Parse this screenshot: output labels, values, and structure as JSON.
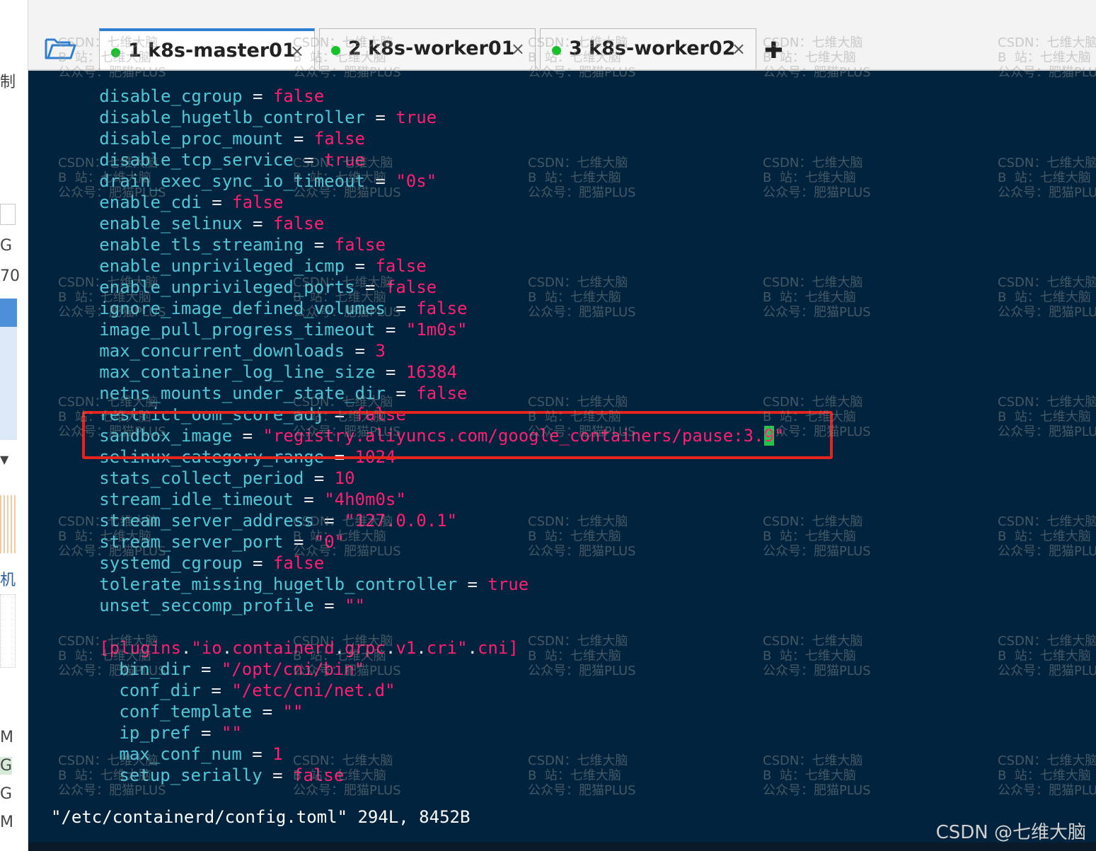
{
  "sidebar": {
    "fragments": [
      "制",
      "G",
      "70",
      "机",
      "M",
      "G",
      "G",
      "M"
    ]
  },
  "tabs": [
    {
      "label": "1 k8s-master01",
      "active": true
    },
    {
      "label": "2 k8s-worker01",
      "active": false
    },
    {
      "label": "3 k8s-worker02",
      "active": false
    }
  ],
  "tab_close_glyph": "×",
  "new_tab_glyph": "✚",
  "terminal": {
    "lines": [
      {
        "indent": 6,
        "key": "disable_cgroup",
        "op": " = ",
        "value": "false"
      },
      {
        "indent": 6,
        "key": "disable_hugetlb_controller",
        "op": " = ",
        "value": "true"
      },
      {
        "indent": 6,
        "key": "disable_proc_mount",
        "op": " = ",
        "value": "false"
      },
      {
        "indent": 6,
        "key": "disable_tcp_service",
        "op": " = ",
        "value": "true"
      },
      {
        "indent": 6,
        "key": "drain_exec_sync_io_timeout",
        "op": " = ",
        "value": "\"0s\""
      },
      {
        "indent": 6,
        "key": "enable_cdi",
        "op": " = ",
        "value": "false"
      },
      {
        "indent": 6,
        "key": "enable_selinux",
        "op": " = ",
        "value": "false"
      },
      {
        "indent": 6,
        "key": "enable_tls_streaming",
        "op": " = ",
        "value": "false"
      },
      {
        "indent": 6,
        "key": "enable_unprivileged_icmp",
        "op": " = ",
        "value": "false"
      },
      {
        "indent": 6,
        "key": "enable_unprivileged_ports",
        "op": " = ",
        "value": "false"
      },
      {
        "indent": 6,
        "key": "ignore_image_defined_volumes",
        "op": " = ",
        "value": "false"
      },
      {
        "indent": 6,
        "key": "image_pull_progress_timeout",
        "op": " = ",
        "value": "\"1m0s\""
      },
      {
        "indent": 6,
        "key": "max_concurrent_downloads",
        "op": " = ",
        "value": "3"
      },
      {
        "indent": 6,
        "key": "max_container_log_line_size",
        "op": " = ",
        "value": "16384"
      },
      {
        "indent": 6,
        "key": "netns_mounts_under_state_dir",
        "op": " = ",
        "value": "false"
      },
      {
        "indent": 6,
        "key": "restrict_oom_score_adj",
        "op": " = ",
        "value": "false"
      },
      {
        "indent": 6,
        "key": "sandbox_image",
        "op": " = ",
        "value": "\"registry.aliyuncs.com/google_containers/pause:3.",
        "cursor": "9",
        "tail": "\""
      },
      {
        "indent": 6,
        "key": "selinux_category_range",
        "op": " = ",
        "value": "1024"
      },
      {
        "indent": 6,
        "key": "stats_collect_period",
        "op": " = ",
        "value": "10"
      },
      {
        "indent": 6,
        "key": "stream_idle_timeout",
        "op": " = ",
        "value": "\"4h0m0s\""
      },
      {
        "indent": 6,
        "key": "stream_server_address",
        "op": " = ",
        "value": "\"127.0.0.1\""
      },
      {
        "indent": 6,
        "key": "stream_server_port",
        "op": " = ",
        "value": "\"0\""
      },
      {
        "indent": 6,
        "key": "systemd_cgroup",
        "op": " = ",
        "value": "false"
      },
      {
        "indent": 6,
        "key": "tolerate_missing_hugetlb_controller",
        "op": " = ",
        "value": "true"
      },
      {
        "indent": 6,
        "key": "unset_seccomp_profile",
        "op": " = ",
        "value": "\"\""
      },
      {
        "indent": 0,
        "key": "",
        "op": "",
        "value": ""
      },
      {
        "indent": 6,
        "section": true,
        "parts": [
          {
            "t": "[plugins",
            "c": "v"
          },
          {
            "t": ".",
            "c": "p"
          },
          {
            "t": "\"io",
            "c": "v"
          },
          {
            "t": ".",
            "c": "p"
          },
          {
            "t": "containerd",
            "c": "v"
          },
          {
            "t": ".",
            "c": "p"
          },
          {
            "t": "grpc",
            "c": "v"
          },
          {
            "t": ".",
            "c": "p"
          },
          {
            "t": "v1",
            "c": "v"
          },
          {
            "t": ".",
            "c": "p"
          },
          {
            "t": "cri\"",
            "c": "v"
          },
          {
            "t": ".",
            "c": "p"
          },
          {
            "t": "cni]",
            "c": "v"
          }
        ]
      },
      {
        "indent": 8,
        "key": "bin_dir",
        "op": " = ",
        "value": "\"/opt/cni/bin\""
      },
      {
        "indent": 8,
        "key": "conf_dir",
        "op": " = ",
        "value": "\"/etc/cni/net.d\""
      },
      {
        "indent": 8,
        "key": "conf_template",
        "op": " = ",
        "value": "\"\""
      },
      {
        "indent": 8,
        "key": "ip_pref",
        "op": " = ",
        "value": "\"\""
      },
      {
        "indent": 8,
        "key": "max_conf_num",
        "op": " = ",
        "value": "1"
      },
      {
        "indent": 8,
        "key": "setup_serially",
        "op": " = ",
        "value": "false"
      }
    ],
    "status": "\"/etc/containerd/config.toml\" 294L, 8452B"
  },
  "watermark": "CSDN：七维大脑\nB  站：七维大脑\n公众号：肥猫PLUS",
  "credit": "CSDN @七维大脑",
  "colors": {
    "terminal_bg": "#01233d",
    "key": "#4ec8d8",
    "value": "#ff1f72",
    "highlight_border": "#e5251d",
    "cursor": "#1fc64a",
    "tab_active_accent": "#2f7fd1",
    "status_dot": "#16c22a"
  }
}
